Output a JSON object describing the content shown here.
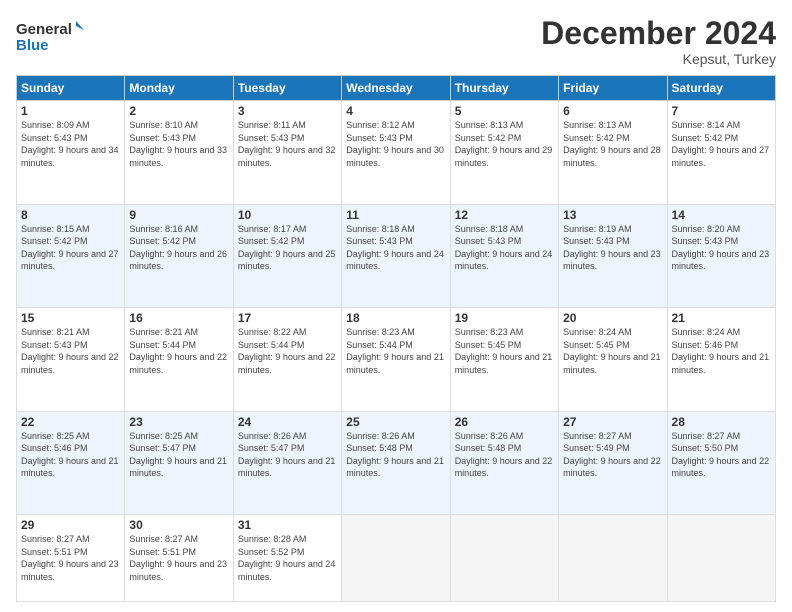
{
  "header": {
    "logo_line1": "General",
    "logo_line2": "Blue",
    "month_title": "December 2024",
    "subtitle": "Kepsut, Turkey"
  },
  "weekdays": [
    "Sunday",
    "Monday",
    "Tuesday",
    "Wednesday",
    "Thursday",
    "Friday",
    "Saturday"
  ],
  "weeks": [
    {
      "alt": false,
      "days": [
        {
          "num": "1",
          "sunrise": "Sunrise: 8:09 AM",
          "sunset": "Sunset: 5:43 PM",
          "daylight": "Daylight: 9 hours and 34 minutes."
        },
        {
          "num": "2",
          "sunrise": "Sunrise: 8:10 AM",
          "sunset": "Sunset: 5:43 PM",
          "daylight": "Daylight: 9 hours and 33 minutes."
        },
        {
          "num": "3",
          "sunrise": "Sunrise: 8:11 AM",
          "sunset": "Sunset: 5:43 PM",
          "daylight": "Daylight: 9 hours and 32 minutes."
        },
        {
          "num": "4",
          "sunrise": "Sunrise: 8:12 AM",
          "sunset": "Sunset: 5:43 PM",
          "daylight": "Daylight: 9 hours and 30 minutes."
        },
        {
          "num": "5",
          "sunrise": "Sunrise: 8:13 AM",
          "sunset": "Sunset: 5:42 PM",
          "daylight": "Daylight: 9 hours and 29 minutes."
        },
        {
          "num": "6",
          "sunrise": "Sunrise: 8:13 AM",
          "sunset": "Sunset: 5:42 PM",
          "daylight": "Daylight: 9 hours and 28 minutes."
        },
        {
          "num": "7",
          "sunrise": "Sunrise: 8:14 AM",
          "sunset": "Sunset: 5:42 PM",
          "daylight": "Daylight: 9 hours and 27 minutes."
        }
      ]
    },
    {
      "alt": true,
      "days": [
        {
          "num": "8",
          "sunrise": "Sunrise: 8:15 AM",
          "sunset": "Sunset: 5:42 PM",
          "daylight": "Daylight: 9 hours and 27 minutes."
        },
        {
          "num": "9",
          "sunrise": "Sunrise: 8:16 AM",
          "sunset": "Sunset: 5:42 PM",
          "daylight": "Daylight: 9 hours and 26 minutes."
        },
        {
          "num": "10",
          "sunrise": "Sunrise: 8:17 AM",
          "sunset": "Sunset: 5:42 PM",
          "daylight": "Daylight: 9 hours and 25 minutes."
        },
        {
          "num": "11",
          "sunrise": "Sunrise: 8:18 AM",
          "sunset": "Sunset: 5:43 PM",
          "daylight": "Daylight: 9 hours and 24 minutes."
        },
        {
          "num": "12",
          "sunrise": "Sunrise: 8:18 AM",
          "sunset": "Sunset: 5:43 PM",
          "daylight": "Daylight: 9 hours and 24 minutes."
        },
        {
          "num": "13",
          "sunrise": "Sunrise: 8:19 AM",
          "sunset": "Sunset: 5:43 PM",
          "daylight": "Daylight: 9 hours and 23 minutes."
        },
        {
          "num": "14",
          "sunrise": "Sunrise: 8:20 AM",
          "sunset": "Sunset: 5:43 PM",
          "daylight": "Daylight: 9 hours and 23 minutes."
        }
      ]
    },
    {
      "alt": false,
      "days": [
        {
          "num": "15",
          "sunrise": "Sunrise: 8:21 AM",
          "sunset": "Sunset: 5:43 PM",
          "daylight": "Daylight: 9 hours and 22 minutes."
        },
        {
          "num": "16",
          "sunrise": "Sunrise: 8:21 AM",
          "sunset": "Sunset: 5:44 PM",
          "daylight": "Daylight: 9 hours and 22 minutes."
        },
        {
          "num": "17",
          "sunrise": "Sunrise: 8:22 AM",
          "sunset": "Sunset: 5:44 PM",
          "daylight": "Daylight: 9 hours and 22 minutes."
        },
        {
          "num": "18",
          "sunrise": "Sunrise: 8:23 AM",
          "sunset": "Sunset: 5:44 PM",
          "daylight": "Daylight: 9 hours and 21 minutes."
        },
        {
          "num": "19",
          "sunrise": "Sunrise: 8:23 AM",
          "sunset": "Sunset: 5:45 PM",
          "daylight": "Daylight: 9 hours and 21 minutes."
        },
        {
          "num": "20",
          "sunrise": "Sunrise: 8:24 AM",
          "sunset": "Sunset: 5:45 PM",
          "daylight": "Daylight: 9 hours and 21 minutes."
        },
        {
          "num": "21",
          "sunrise": "Sunrise: 8:24 AM",
          "sunset": "Sunset: 5:46 PM",
          "daylight": "Daylight: 9 hours and 21 minutes."
        }
      ]
    },
    {
      "alt": true,
      "days": [
        {
          "num": "22",
          "sunrise": "Sunrise: 8:25 AM",
          "sunset": "Sunset: 5:46 PM",
          "daylight": "Daylight: 9 hours and 21 minutes."
        },
        {
          "num": "23",
          "sunrise": "Sunrise: 8:25 AM",
          "sunset": "Sunset: 5:47 PM",
          "daylight": "Daylight: 9 hours and 21 minutes."
        },
        {
          "num": "24",
          "sunrise": "Sunrise: 8:26 AM",
          "sunset": "Sunset: 5:47 PM",
          "daylight": "Daylight: 9 hours and 21 minutes."
        },
        {
          "num": "25",
          "sunrise": "Sunrise: 8:26 AM",
          "sunset": "Sunset: 5:48 PM",
          "daylight": "Daylight: 9 hours and 21 minutes."
        },
        {
          "num": "26",
          "sunrise": "Sunrise: 8:26 AM",
          "sunset": "Sunset: 5:48 PM",
          "daylight": "Daylight: 9 hours and 22 minutes."
        },
        {
          "num": "27",
          "sunrise": "Sunrise: 8:27 AM",
          "sunset": "Sunset: 5:49 PM",
          "daylight": "Daylight: 9 hours and 22 minutes."
        },
        {
          "num": "28",
          "sunrise": "Sunrise: 8:27 AM",
          "sunset": "Sunset: 5:50 PM",
          "daylight": "Daylight: 9 hours and 22 minutes."
        }
      ]
    },
    {
      "alt": false,
      "days": [
        {
          "num": "29",
          "sunrise": "Sunrise: 8:27 AM",
          "sunset": "Sunset: 5:51 PM",
          "daylight": "Daylight: 9 hours and 23 minutes."
        },
        {
          "num": "30",
          "sunrise": "Sunrise: 8:27 AM",
          "sunset": "Sunset: 5:51 PM",
          "daylight": "Daylight: 9 hours and 23 minutes."
        },
        {
          "num": "31",
          "sunrise": "Sunrise: 8:28 AM",
          "sunset": "Sunset: 5:52 PM",
          "daylight": "Daylight: 9 hours and 24 minutes."
        },
        null,
        null,
        null,
        null
      ]
    }
  ]
}
